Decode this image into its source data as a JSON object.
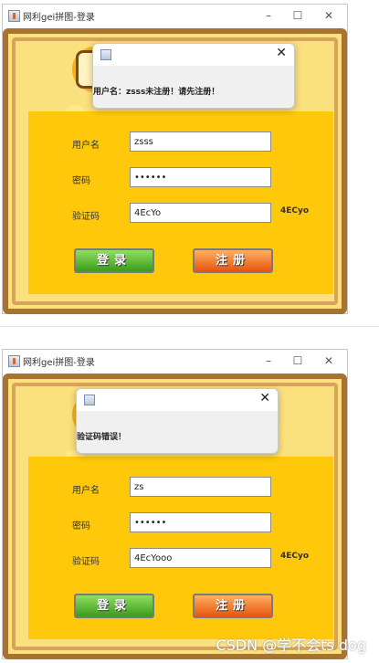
{
  "windows": [
    {
      "title": "网利gei拼图-登录",
      "controls": {
        "minimize": "–",
        "maximize": "☐",
        "close": "✕"
      },
      "form": {
        "username_label": "用户名",
        "username_value": "zsss",
        "password_label": "密码",
        "password_value": "••••••",
        "captcha_label": "验证码",
        "captcha_value": "4EcYo",
        "captcha_code": "4ECyo",
        "login_label": "登录",
        "register_label": "注册"
      },
      "dialog": {
        "close": "✕",
        "message": "用户名：zsss未注册！请先注册！"
      }
    },
    {
      "title": "网利gei拼图-登录",
      "controls": {
        "minimize": "–",
        "maximize": "☐",
        "close": "✕"
      },
      "form": {
        "username_label": "用户名",
        "username_value": "zs",
        "password_label": "密码",
        "password_value": "••••••",
        "captcha_label": "验证码",
        "captcha_value": "4EcYooo",
        "captcha_code": "4ECyo",
        "login_label": "登录",
        "register_label": "注册"
      },
      "dialog": {
        "close": "✕",
        "message": "验证码错误！"
      }
    }
  ],
  "watermark": "CSDN @学不会ts dog"
}
